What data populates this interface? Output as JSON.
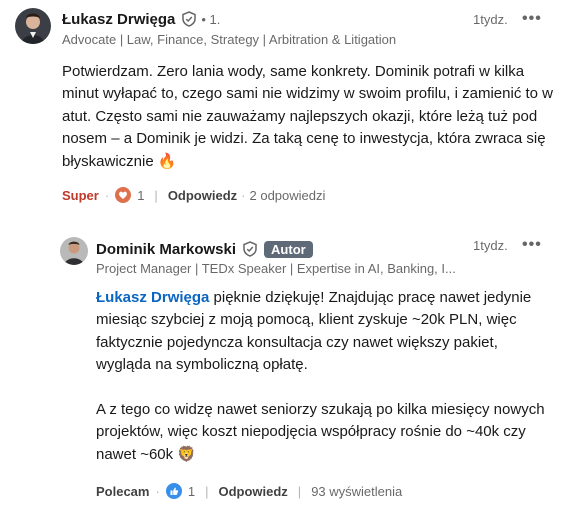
{
  "comment1": {
    "author": "Łukasz Drwięga",
    "degree": "• 1.",
    "headline": "Advocate | Law, Finance, Strategy | Arbitration & Litigation",
    "time": "1tydz.",
    "more": "•••",
    "text": "Potwierdzam. Zero lania wody, same konkrety. Dominik potrafi w kilka minut wyłapać to, czego sami nie widzimy w swoim profilu, i zamienić to w atut. Często sami nie zauważamy najlepszych okazji, które leżą tuż pod nosem – a Dominik je widzi. Za taką cenę to inwestycja, która zwraca się błyskawicznie 🔥",
    "reaction_label": "Super",
    "reaction_count": "1",
    "reply_label": "Odpowiedz",
    "replies": "2 odpowiedzi",
    "reaction_icon": "heart-icon"
  },
  "comment2": {
    "author": "Dominik Markowski",
    "badge": "Autor",
    "headline": "Project Manager | TEDx Speaker | Expertise in AI, Banking, I...",
    "time": "1tydz.",
    "more": "•••",
    "mention": "Łukasz Drwięga",
    "text_after_mention": " pięknie dziękuję! Znajdując pracę nawet jedynie miesiąc szybciej z moją pomocą, klient zyskuje ~20k PLN, więc faktycznie pojedyncza konsultacja czy nawet większy pakiet, wygląda na symboliczną opłatę.",
    "text_para2": "A z tego co widzę nawet seniorzy szukają po kilka miesięcy nowych projektów, więc koszt niepodjęcia współpracy rośnie do ~40k czy nawet ~60k 🦁",
    "reaction_label": "Polecam",
    "reaction_count": "1",
    "reply_label": "Odpowiedz",
    "views": "93 wyświetlenia",
    "reaction_icon": "like-icon"
  },
  "colors": {
    "mention": "#0a66c2",
    "super": "#c0392b",
    "badge": "#5e6a77"
  }
}
